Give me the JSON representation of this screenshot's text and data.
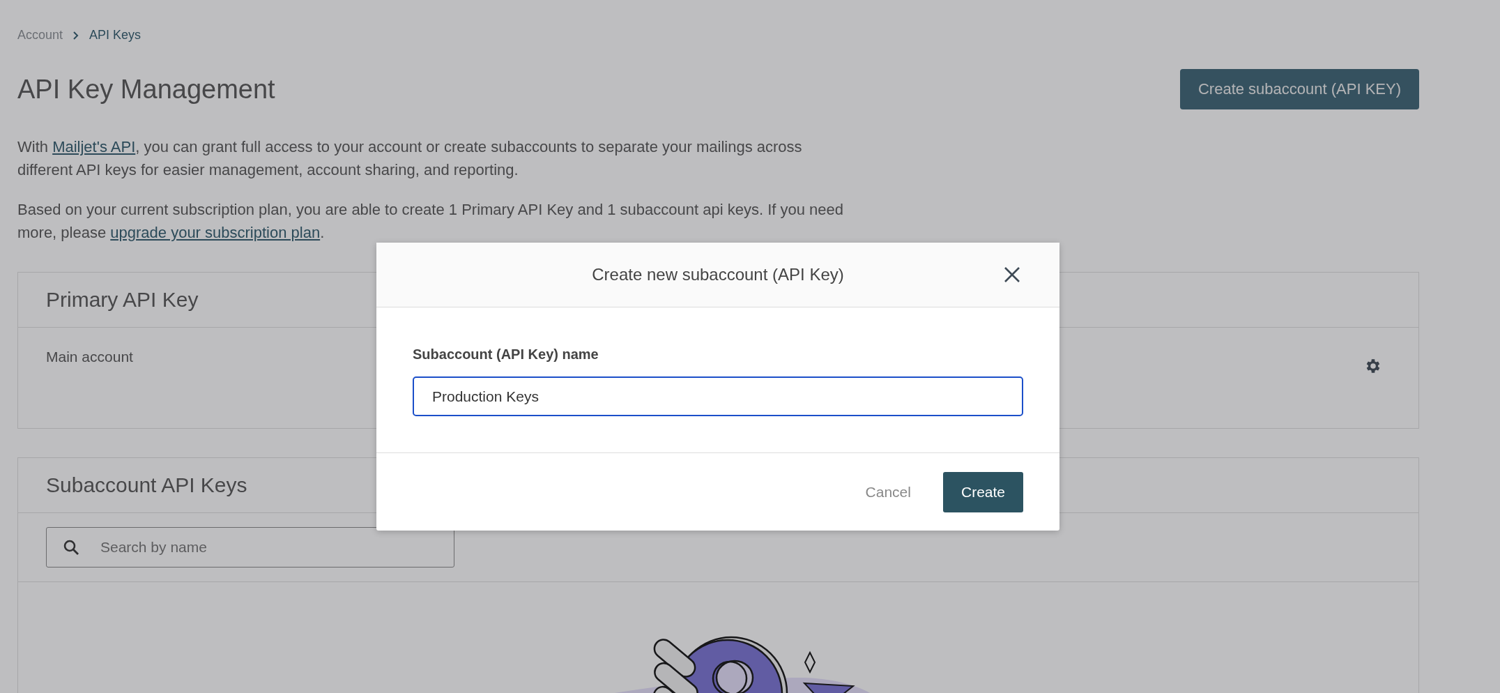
{
  "breadcrumb": [
    {
      "label": "Account",
      "selected": false
    },
    {
      "label": "API Keys",
      "selected": true
    }
  ],
  "title": "API Key Management",
  "primary_button": "Create subaccount (API KEY)",
  "paragraphs": [
    [
      {
        "kind": "text",
        "text": "With "
      },
      {
        "kind": "link",
        "text": "Mailjet's API"
      },
      {
        "kind": "text",
        "text": ", you can grant full access to your account or create subaccounts to separate your mailings across different API keys for easier management, account sharing, and reporting."
      }
    ],
    [
      {
        "kind": "text",
        "text": "Based on your current subscription plan, you are able to create 1 Primary API Key and 1 subaccount api keys. If you need more, please "
      },
      {
        "kind": "link",
        "text": "upgrade your subscription plan"
      },
      {
        "kind": "text",
        "text": "."
      }
    ]
  ],
  "primary_card": {
    "title": "Primary API Key",
    "row_label": "Main account"
  },
  "subaccount_card": {
    "title": "Subaccount API Keys",
    "search": {
      "placeholder": "Search by name"
    }
  },
  "modal": {
    "title": "Create new subaccount (API Key)",
    "field_label": "Subaccount (API Key) name",
    "field_value": "Production Keys",
    "buttons": [
      {
        "kind": "secondary",
        "label": "Cancel"
      },
      {
        "kind": "primary",
        "label": "Create"
      }
    ]
  }
}
